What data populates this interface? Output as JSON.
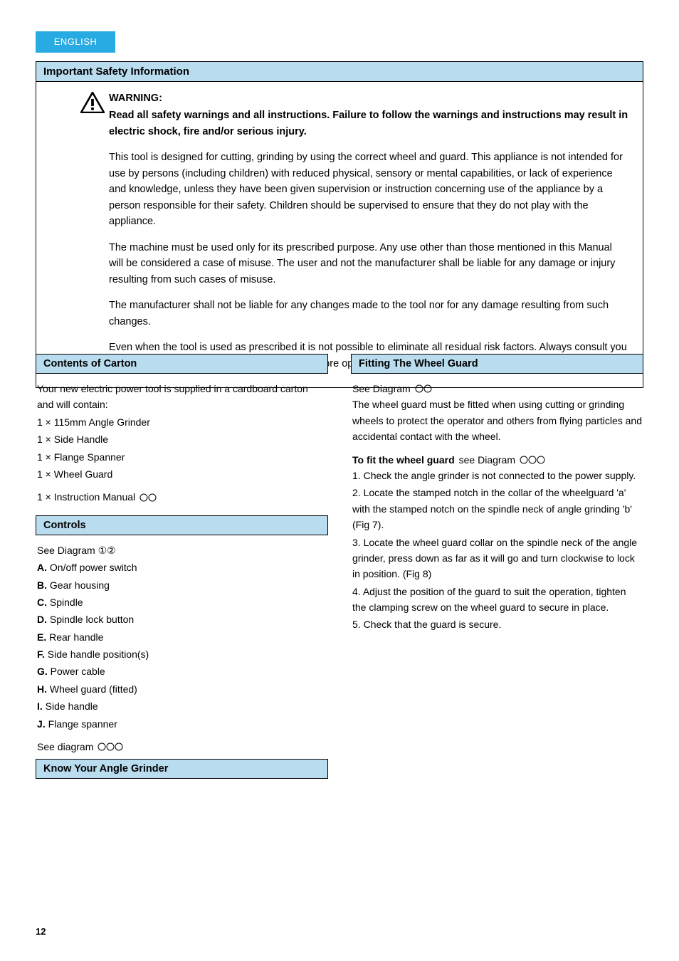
{
  "tab_label": "ENGLISH",
  "safety": {
    "header": "Important Safety Information",
    "warn_heading": "WARNING:",
    "warn_intro": "Read all safety warnings and all instructions. Failure to follow the warnings and instructions may result in electric shock, fire and/or serious injury.",
    "p1": "This tool is designed for cutting, grinding by using the correct wheel and guard. This appliance is not intended for use by persons (including children) with reduced physical, sensory or mental capabilities, or lack of experience and knowledge, unless they have been given supervision or instruction concerning use of the appliance by a person responsible for their safety. Children should be supervised to ensure that they do not play with the appliance.",
    "p2": "The machine must be used only for its prescribed purpose. Any use other than those mentioned in this Manual will be considered a case of misuse. The user and not the manufacturer shall be liable for any damage or injury resulting from such cases of misuse.",
    "p3": "The manufacturer shall not be liable for any changes made to the tool nor for any damage resulting from such changes.",
    "p4": "Even when the tool is used as prescribed it is not possible to eliminate all residual risk factors. Always consult you local Professional Health Advisor for advice before operating this machine."
  },
  "contents": {
    "header": "Contents of Carton",
    "intro": "Your new electric power tool is supplied in a cardboard carton and will contain:",
    "items": [
      "1 × 115mm Angle Grinder",
      "1 × Side Handle",
      "1 × Flange Spanner",
      "1 × Wheel Guard",
      "1 × Instruction Manual"
    ]
  },
  "known_symbols_header": "Know Your Angle Grinder",
  "controls": {
    "header": "Controls",
    "intro_label": "See Diagram",
    "intro_fig": "①②",
    "items": [
      {
        "label": "A.",
        "text": "On/off power switch"
      },
      {
        "label": "B.",
        "text": "Gear housing"
      },
      {
        "label": "C.",
        "text": "Spindle"
      },
      {
        "label": "D.",
        "text": "Spindle lock button"
      },
      {
        "label": "E.",
        "text": "Rear handle"
      },
      {
        "label": "F.",
        "text": "Side handle position(s)"
      },
      {
        "label": "G.",
        "text": "Power cable"
      },
      {
        "label": "H.",
        "text": "Wheel guard (fitted)"
      },
      {
        "label": "I.",
        "text": "Side handle"
      },
      {
        "label": "J.",
        "text": "Flange spanner"
      }
    ],
    "see_label": "See diagram",
    "see_fig": "①②③"
  },
  "guard": {
    "header": "Fitting The Wheel Guard",
    "see1_label": "See Diagram",
    "see1_fig": "④⑤",
    "intro": "The wheel guard must be fitted when using cutting or grinding wheels to protect the operator and others from flying particles and accidental contact with the wheel.",
    "steps_header": "To fit the wheel guard",
    "steps_see_label": "see Diagram",
    "steps_see_fig": "⑥⑦⑧",
    "steps": [
      {
        "n": "1.",
        "text": "Check the angle grinder is not connected to the power supply."
      },
      {
        "n": "2.",
        "text": "Locate the stamped notch in the collar of the wheelguard 'a' with the stamped notch on the spindle neck of angle grinding 'b' (Fig 7)."
      },
      {
        "n": "3.",
        "text": "Locate the wheel guard collar on the spindle neck of the angle grinder, press down as far as it will go and turn clockwise to lock in position. (Fig 8)"
      },
      {
        "n": "4.",
        "text": "Adjust the position of the guard to suit the operation, tighten the clamping screw on the wheel guard to secure in place."
      },
      {
        "n": "5.",
        "text": "Check that the guard is secure."
      }
    ]
  },
  "page_number": "12"
}
